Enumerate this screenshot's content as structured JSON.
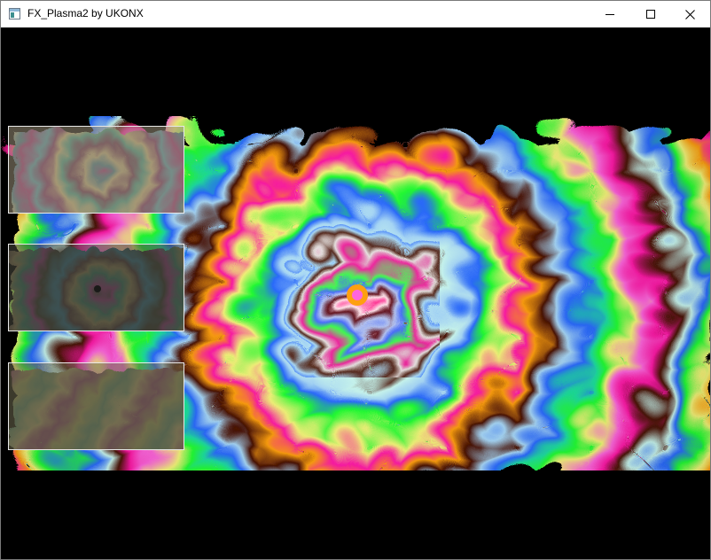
{
  "window": {
    "title": "FX_Plasma2 by UKONX",
    "app_icon": "window-app-icon",
    "controls": {
      "minimize_icon": "minimize-icon",
      "maximize_icon": "maximize-icon",
      "close_icon": "close-icon"
    }
  },
  "canvas": {
    "background_color": "#000000",
    "palette": [
      "#f5f57a",
      "#c9f7f0",
      "#a8d8f8",
      "#2b6bff",
      "#1fe0a0",
      "#22ff33",
      "#ffa010",
      "#ff66dd",
      "#ff1aa8",
      "#4a1205",
      "#ffffff"
    ],
    "previews": [
      {
        "name": "preview-1",
        "tint": "#9a8f78",
        "opacity": 0.62
      },
      {
        "name": "preview-2",
        "tint": "#4a4a40",
        "opacity": 0.78
      },
      {
        "name": "preview-3",
        "tint": "#6e6a50",
        "opacity": 0.7
      }
    ]
  }
}
